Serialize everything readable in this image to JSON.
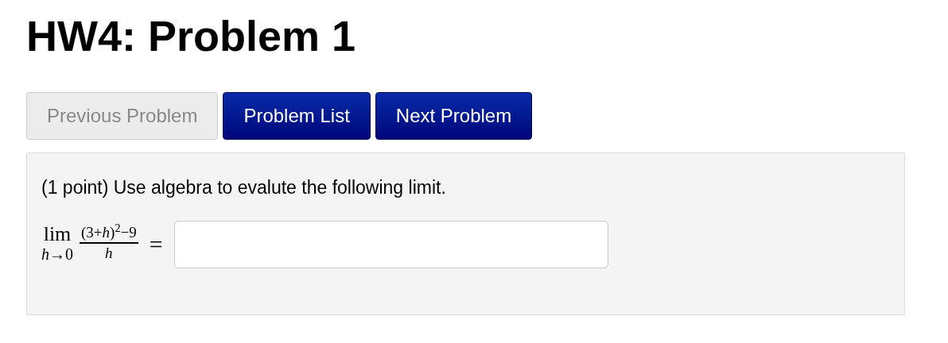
{
  "title": "HW4: Problem 1",
  "nav_buttons": [
    {
      "label": "Previous Problem",
      "disabled": true
    },
    {
      "label": "Problem List",
      "disabled": false
    },
    {
      "label": "Next Problem",
      "disabled": false
    }
  ],
  "problem": {
    "text": "(1 point) Use algebra to evalute the following limit.",
    "limit": {
      "operator": "lim",
      "subscript": "*h*→0",
      "numerator": "(3+*h*)$^{2}$−9",
      "denominator": "*h*",
      "relation": "="
    }
  }
}
